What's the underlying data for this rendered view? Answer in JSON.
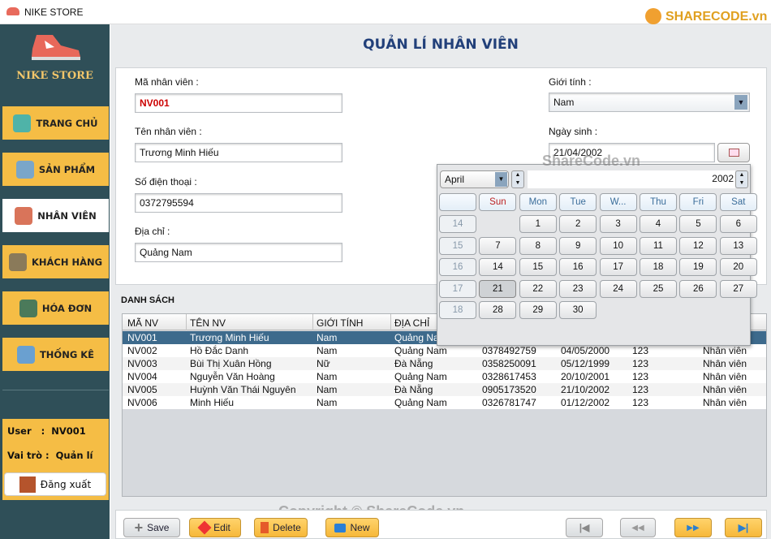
{
  "window": {
    "title": "NIKE STORE"
  },
  "watermark": {
    "logo": "SHARECODE.vn",
    "overlay": "ShareCode.vn",
    "copyright": "Copyright © ShareCode.vn"
  },
  "sidebar": {
    "brand": "NIKE STORE",
    "items": [
      {
        "label": "TRANG CHỦ",
        "icon": "home-icon"
      },
      {
        "label": "SẢN PHẨM",
        "icon": "clothes-icon"
      },
      {
        "label": "NHÂN VIÊN",
        "icon": "staff-icon",
        "active": true
      },
      {
        "label": "KHÁCH HÀNG",
        "icon": "customer-icon"
      },
      {
        "label": "HÓA ĐƠN",
        "icon": "invoice-icon"
      },
      {
        "label": "THỐNG KÊ",
        "icon": "statistics-icon"
      }
    ],
    "user_label": "User   :  NV001",
    "role_label": "Vai trò :  Quản lí",
    "logout": "Đăng xuất"
  },
  "page": {
    "title": "QUẢN LÍ NHÂN VIÊN"
  },
  "form": {
    "id_label": "Mã nhân viên :",
    "id_value": "NV001",
    "name_label": "Tên nhân viên :",
    "name_value": "Trương Minh Hiếu",
    "phone_label": "Số điện thoại :",
    "phone_value": "0372795594",
    "address_label": "Địa chỉ :",
    "address_value": "Quảng Nam",
    "gender_label": "Giới tính :",
    "gender_value": "Nam",
    "dob_label": "Ngày sinh :",
    "dob_value": "21/04/2002"
  },
  "calendar": {
    "month": "April",
    "year": "2002",
    "weekdays": [
      "Sun",
      "Mon",
      "Tue",
      "W...",
      "Thu",
      "Fri",
      "Sat"
    ],
    "weeks": [
      {
        "wk": "14",
        "days": [
          "",
          "1",
          "2",
          "3",
          "4",
          "5",
          "6"
        ]
      },
      {
        "wk": "15",
        "days": [
          "7",
          "8",
          "9",
          "10",
          "11",
          "12",
          "13"
        ]
      },
      {
        "wk": "16",
        "days": [
          "14",
          "15",
          "16",
          "17",
          "18",
          "19",
          "20"
        ]
      },
      {
        "wk": "17",
        "days": [
          "21",
          "22",
          "23",
          "24",
          "25",
          "26",
          "27"
        ]
      },
      {
        "wk": "18",
        "days": [
          "28",
          "29",
          "30",
          "",
          "",
          "",
          ""
        ]
      }
    ],
    "selected": "21"
  },
  "list": {
    "label": "DANH SÁCH",
    "columns": [
      "MÃ NV",
      "TÊN NV",
      "GIỚI TÍNH",
      "ĐỊA CHỈ",
      "",
      "",
      "",
      ""
    ],
    "rows": [
      [
        "NV001",
        "Trương Minh Hiếu",
        "Nam",
        "Quảng Nam",
        "",
        "",
        "",
        ""
      ],
      [
        "NV002",
        "Hồ Đắc Danh",
        "Nam",
        "Quảng Nam",
        "0378492759",
        "04/05/2000",
        "123",
        "Nhân viên"
      ],
      [
        "NV003",
        "Bùi Thị Xuân Hồng",
        "Nữ",
        "Đà Nẵng",
        "0358250091",
        "05/12/1999",
        "123",
        "Nhân viên"
      ],
      [
        "NV004",
        "Nguyễn Văn Hoàng",
        "Nam",
        "Quảng Nam",
        "0328617453",
        "20/10/2001",
        "123",
        "Nhân viên"
      ],
      [
        "NV005",
        "Huỳnh Văn Thái Nguyên",
        "Nam",
        "Đà Nẵng",
        "0905173520",
        "21/10/2002",
        "123",
        "Nhân viên"
      ],
      [
        "NV006",
        "Minh Hiếu",
        "Nam",
        "Quảng Nam",
        "0326781747",
        "01/12/2002",
        "123",
        "Nhân viên"
      ]
    ]
  },
  "actions": {
    "save": "Save",
    "edit": "Edit",
    "delete": "Delete",
    "new": "New"
  },
  "colors": {
    "sidebar": "#2f4f58",
    "accent": "#f5bd45",
    "title": "#22407a",
    "selected_row": "#3d6a8c",
    "id_text": "#cc0000"
  }
}
